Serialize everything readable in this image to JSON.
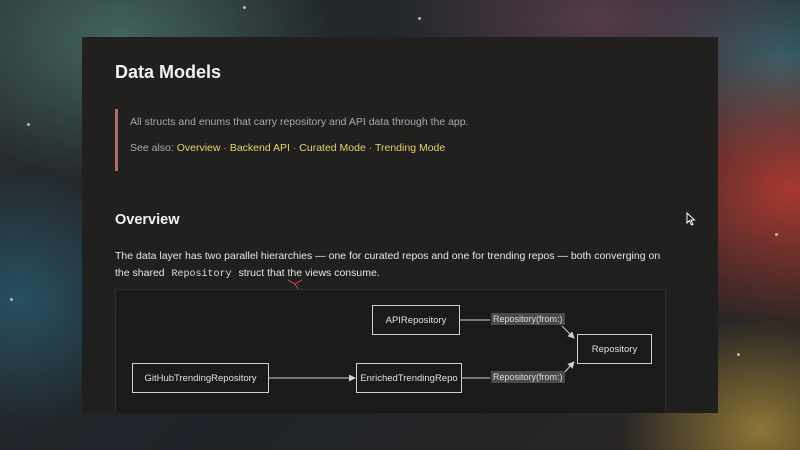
{
  "page": {
    "title": "Data Models",
    "description": "All structs and enums that carry repository and API data through the app.",
    "see_also_label": "See also:",
    "see_also_links": [
      "Overview",
      "Backend API",
      "Curated Mode",
      "Trending Mode"
    ],
    "separator": "·"
  },
  "overview": {
    "heading": "Overview",
    "text_before": "The data layer has two parallel hierarchies — one for curated repos and one for trending repos — both converging on the shared",
    "code": "Repository",
    "text_after": "struct that the views consume."
  },
  "diagram": {
    "nodes": {
      "api_repository": "APIRepository",
      "github_trending": "GitHubTrendingRepository",
      "enriched_trending": "EnrichedTrendingRepo",
      "repository": "Repository"
    },
    "edge_labels": {
      "api_to_repo": "Repository(from:)",
      "enriched_to_repo": "Repository(from:)"
    }
  },
  "colors": {
    "link": "#e4d36b",
    "callout_border": "#b46a6a"
  }
}
